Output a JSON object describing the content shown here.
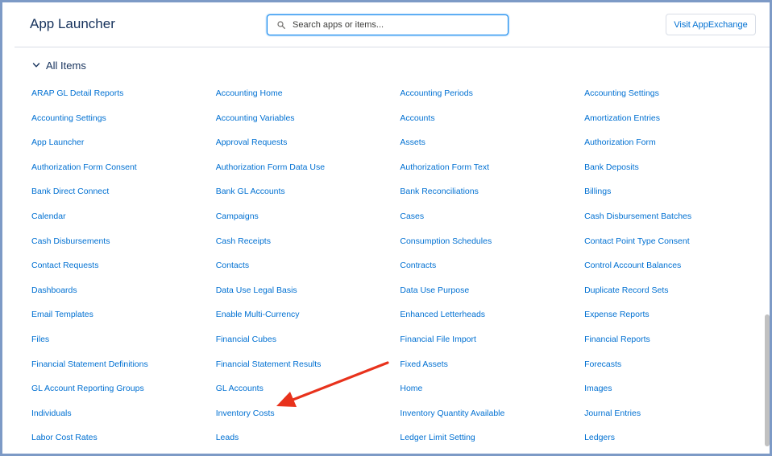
{
  "header": {
    "title": "App Launcher",
    "search_placeholder": "Search apps or items...",
    "visit_button": "Visit AppExchange"
  },
  "section": {
    "label": "All Items"
  },
  "items": [
    "ARAP GL Detail Reports",
    "Accounting Home",
    "Accounting Periods",
    "Accounting Settings",
    "Accounting Settings",
    "Accounting Variables",
    "Accounts",
    "Amortization Entries",
    "App Launcher",
    "Approval Requests",
    "Assets",
    "Authorization Form",
    "Authorization Form Consent",
    "Authorization Form Data Use",
    "Authorization Form Text",
    "Bank Deposits",
    "Bank Direct Connect",
    "Bank GL Accounts",
    "Bank Reconciliations",
    "Billings",
    "Calendar",
    "Campaigns",
    "Cases",
    "Cash Disbursement Batches",
    "Cash Disbursements",
    "Cash Receipts",
    "Consumption Schedules",
    "Contact Point Type Consent",
    "Contact Requests",
    "Contacts",
    "Contracts",
    "Control Account Balances",
    "Dashboards",
    "Data Use Legal Basis",
    "Data Use Purpose",
    "Duplicate Record Sets",
    "Email Templates",
    "Enable Multi-Currency",
    "Enhanced Letterheads",
    "Expense Reports",
    "Files",
    "Financial Cubes",
    "Financial File Import",
    "Financial Reports",
    "Financial Statement Definitions",
    "Financial Statement Results",
    "Fixed Assets",
    "Forecasts",
    "GL Account Reporting Groups",
    "GL Accounts",
    "Home",
    "Images",
    "Individuals",
    "Inventory Costs",
    "Inventory Quantity Available",
    "Journal Entries",
    "Labor Cost Rates",
    "Leads",
    "Ledger Limit Setting",
    "Ledgers"
  ],
  "colors": {
    "link": "#0070d2",
    "title": "#16325c",
    "annotation_arrow": "#e8321c",
    "frame_border": "#7d9ac6"
  },
  "icons": {
    "search": "search-icon",
    "section_toggle": "chevron-down-icon",
    "annotation": "arrow-annotation"
  }
}
